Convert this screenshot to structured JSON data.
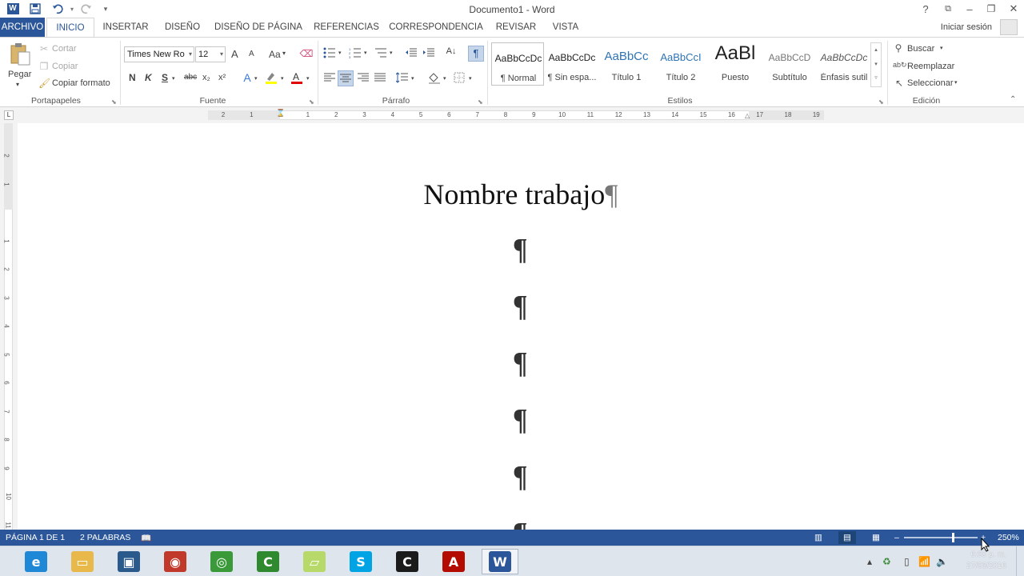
{
  "window": {
    "title": "Documento1 - Word",
    "controls": {
      "help": "?",
      "display_options": "⧉",
      "minimize": "–",
      "restore": "❐",
      "close": "✕"
    }
  },
  "quick_access": {
    "app_icon": "W",
    "save_icon": "save-icon",
    "undo_icon": "undo-icon",
    "redo_icon": "redo-icon",
    "customize_icon": "▾"
  },
  "tabs": [
    "ARCHIVO",
    "INICIO",
    "INSERTAR",
    "DISEÑO",
    "DISEÑO DE PÁGINA",
    "REFERENCIAS",
    "CORRESPONDENCIA",
    "REVISAR",
    "VISTA"
  ],
  "signin": "Iniciar sesión",
  "ribbon": {
    "clipboard": {
      "label": "Portapapeles",
      "paste": "Pegar",
      "cut": "Cortar",
      "copy": "Copiar",
      "format_painter": "Copiar formato"
    },
    "font": {
      "label": "Fuente",
      "font_name": "Times New Ro",
      "font_size": "12",
      "grow": "A",
      "shrink": "A",
      "case": "Aa",
      "bold": "N",
      "italic": "K",
      "underline": "S",
      "strike": "abc",
      "subscript": "x₂",
      "superscript": "x²"
    },
    "paragraph": {
      "label": "Párrafo",
      "show_marks": "¶"
    },
    "styles": {
      "label": "Estilos",
      "items": [
        {
          "preview": "AaBbCcDc",
          "name": "¶ Normal"
        },
        {
          "preview": "AaBbCcDc",
          "name": "¶ Sin espa..."
        },
        {
          "preview": "AaBbCc",
          "name": "Título 1"
        },
        {
          "preview": "AaBbCcI",
          "name": "Título 2"
        },
        {
          "preview": "AaBl",
          "name": "Puesto"
        },
        {
          "preview": "AaBbCcD",
          "name": "Subtítulo"
        },
        {
          "preview": "AaBbCcDc",
          "name": "Énfasis sutil"
        }
      ]
    },
    "editing": {
      "label": "Edición",
      "find": "Buscar",
      "replace": "Reemplazar",
      "select": "Seleccionar"
    }
  },
  "ruler": {
    "tab_stop": "L",
    "ticks": [
      "2",
      "1",
      "",
      "1",
      "2",
      "3",
      "4",
      "5",
      "6",
      "7",
      "8",
      "9",
      "10",
      "11",
      "12",
      "13",
      "14",
      "15",
      "16",
      "17",
      "18",
      "19"
    ],
    "vticks": [
      "2",
      "1",
      "",
      "1",
      "2",
      "3",
      "4",
      "5",
      "6",
      "7",
      "8",
      "9",
      "10",
      "11"
    ]
  },
  "document": {
    "heading": "Nombre trabajo",
    "pilcrow": "¶"
  },
  "status": {
    "page": "PÁGINA 1 DE 1",
    "words": "2 PALABRAS",
    "zoom_minus": "–",
    "zoom_plus": "+",
    "zoom": "250%"
  },
  "taskbar": {
    "time": "6:00 p. m.",
    "date": "27/06/2016",
    "apps": [
      {
        "name": "internet-explorer",
        "glyph": "e",
        "color": "#1e88d6"
      },
      {
        "name": "file-explorer",
        "glyph": "▭",
        "color": "#e8b84a"
      },
      {
        "name": "desktop-app",
        "glyph": "▣",
        "color": "#2a5a8c"
      },
      {
        "name": "globe-app",
        "glyph": "◉",
        "color": "#c0392b"
      },
      {
        "name": "chrome",
        "glyph": "◎",
        "color": "#3a9a3a"
      },
      {
        "name": "camtasia",
        "glyph": "C",
        "color": "#2f8a2f"
      },
      {
        "name": "folder-app",
        "glyph": "▱",
        "color": "#b7d96a"
      },
      {
        "name": "skype",
        "glyph": "S",
        "color": "#00a4e4"
      },
      {
        "name": "camtasia-recorder",
        "glyph": "C",
        "color": "#1b1b1b"
      },
      {
        "name": "acrobat",
        "glyph": "A",
        "color": "#b30b00"
      },
      {
        "name": "word",
        "glyph": "W",
        "color": "#2b579a"
      }
    ]
  }
}
